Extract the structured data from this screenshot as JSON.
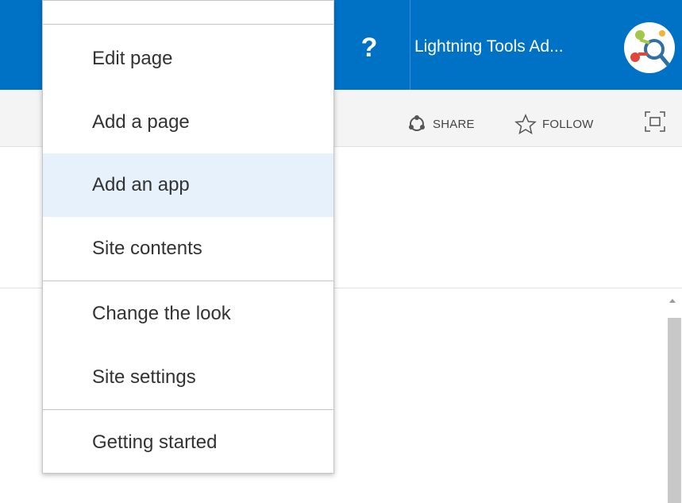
{
  "suite_bar": {
    "help_label": "?",
    "user_name": "Lightning Tools Ad...",
    "accent_color": "#0072c6"
  },
  "actions": {
    "share_label": "SHARE",
    "follow_label": "FOLLOW"
  },
  "menu": {
    "items": [
      {
        "label": "Edit page"
      },
      {
        "label": "Add a page"
      },
      {
        "label": "Add an app",
        "highlighted": true
      },
      {
        "label": "Site contents"
      },
      {
        "label": "Change the look"
      },
      {
        "label": "Site settings"
      },
      {
        "label": "Getting started"
      }
    ]
  },
  "icons": [
    "help-icon",
    "share-icon",
    "star-icon",
    "focus-icon",
    "avatar-logo-icon"
  ]
}
